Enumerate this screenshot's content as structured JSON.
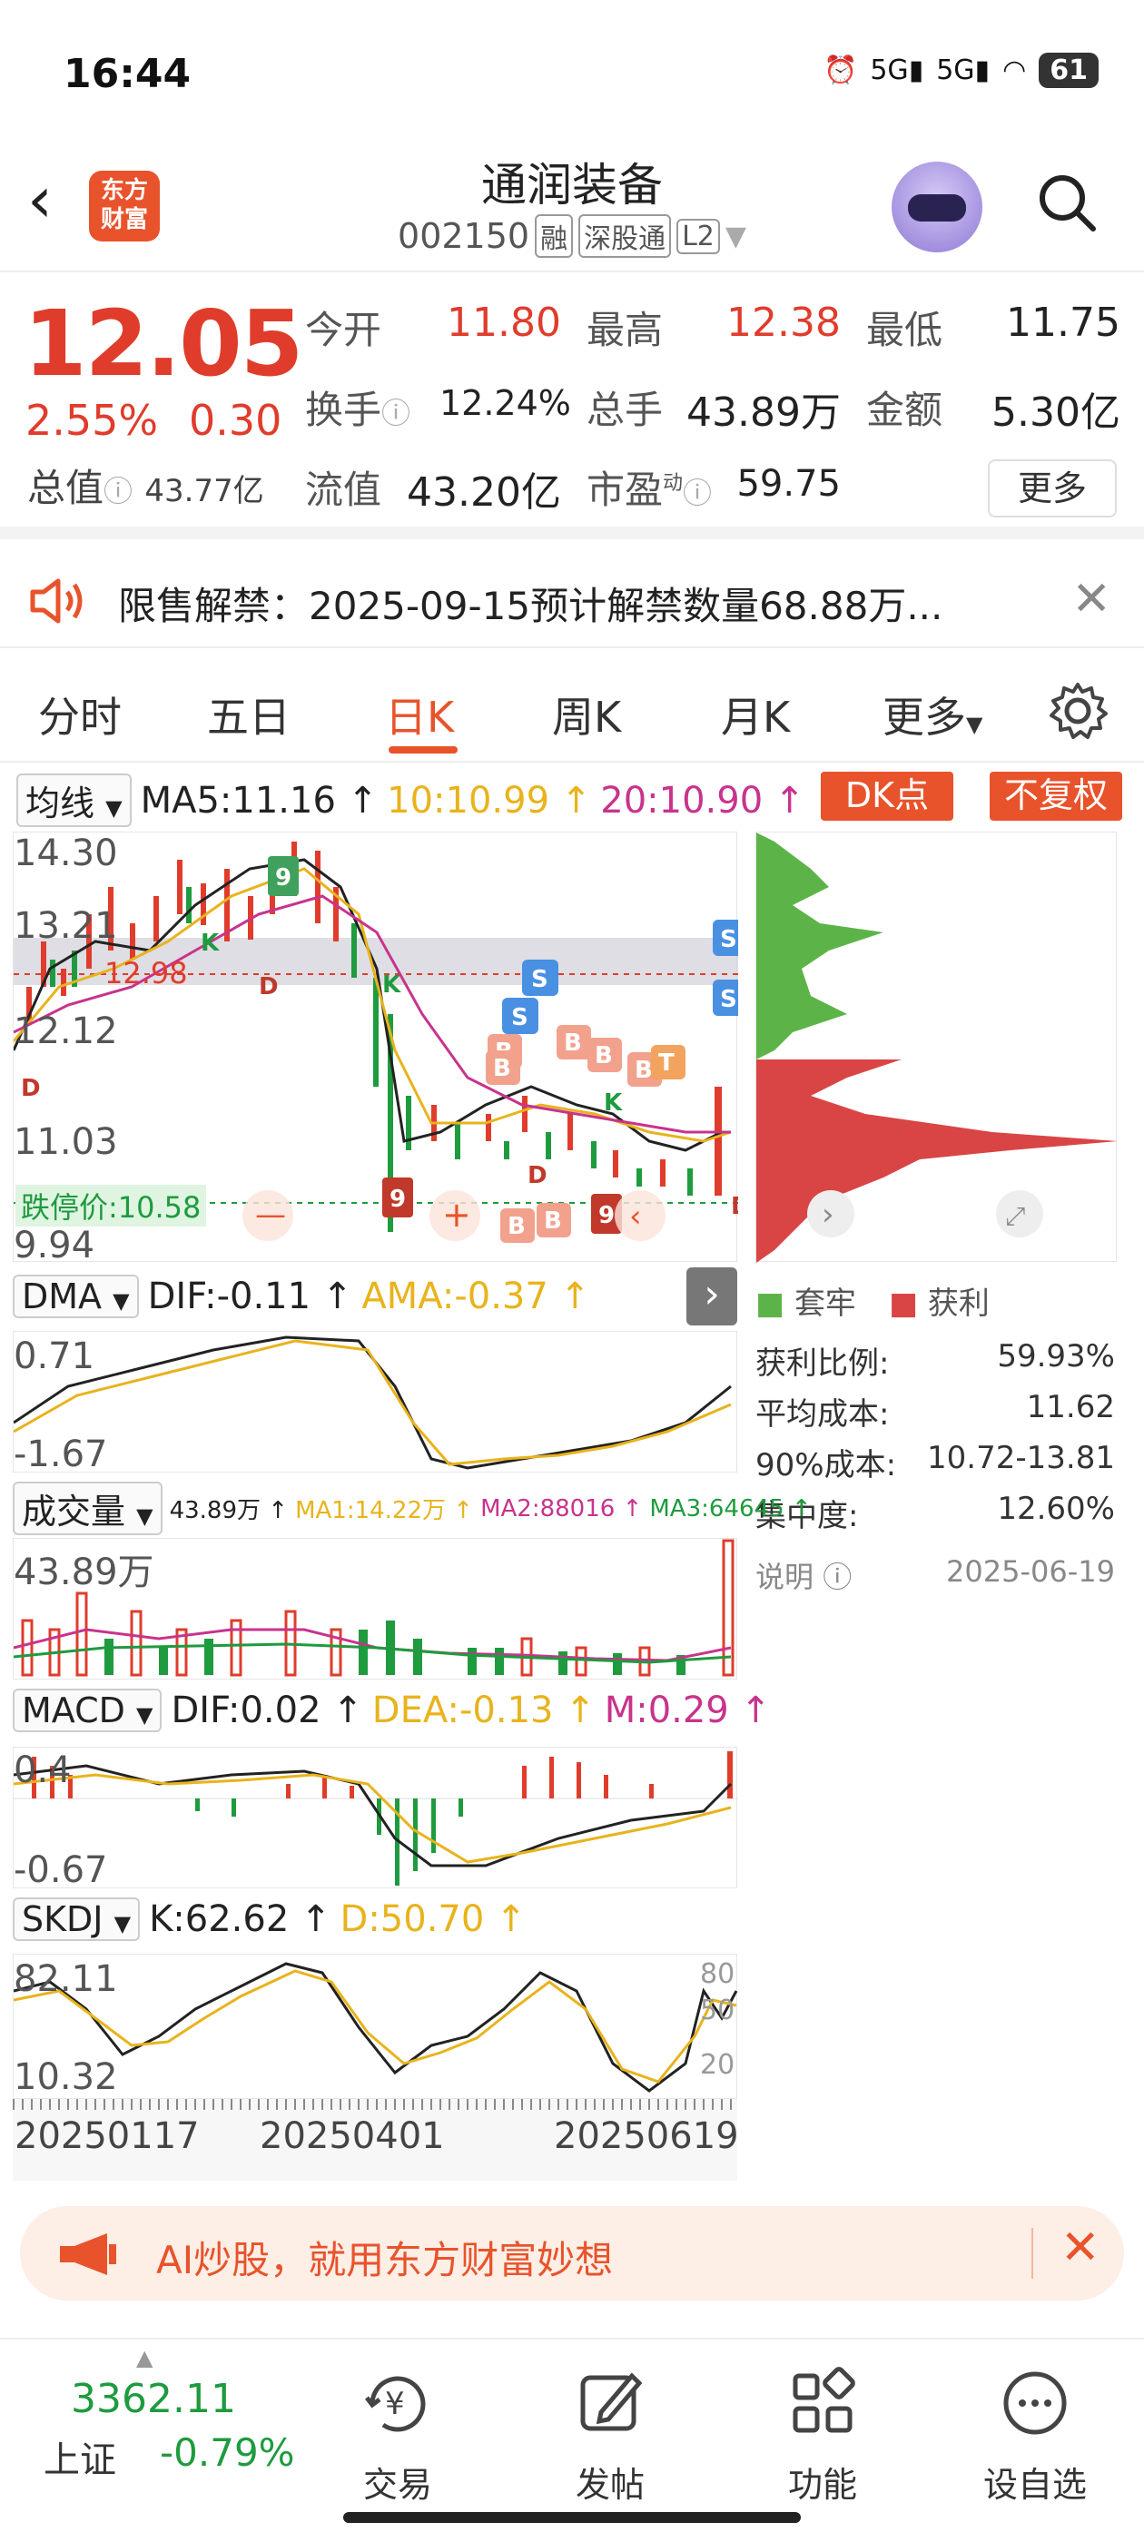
{
  "status": {
    "time": "16:44",
    "battery": "61",
    "net1": "5G",
    "net2": "5G"
  },
  "header": {
    "logo_line1": "东方",
    "logo_line2": "财富",
    "name": "通润装备",
    "code": "002150",
    "tag1": "融",
    "tag2": "深股通",
    "tag3": "L2"
  },
  "quote": {
    "price": "12.05",
    "change_pct": "2.55%",
    "change": "0.30",
    "open_label": "今开",
    "open": "11.80",
    "high_label": "最高",
    "high": "12.38",
    "low_label": "最低",
    "low": "11.75",
    "turnover_label": "换手",
    "turnover": "12.24%",
    "volume_label": "总手",
    "volume": "43.89万",
    "amount_label": "金额",
    "amount": "5.30亿",
    "mktcap_label": "总值",
    "mktcap": "43.77亿",
    "float_label": "流值",
    "float": "43.20亿",
    "pe_label": "市盈",
    "pe_sup": "动",
    "pe": "59.75",
    "more": "更多"
  },
  "notice": {
    "text": "限售解禁：2025-09-15预计解禁数量68.88万..."
  },
  "tabs": {
    "t1": "分时",
    "t2": "五日",
    "t3": "日K",
    "t4": "周K",
    "t5": "月K",
    "t6": "更多",
    "active": "日K"
  },
  "kline": {
    "ma_select": "均线",
    "ma5": "MA5:11.16 ↑",
    "ma10": "10:10.99 ↑",
    "ma20": "20:10.90 ↑",
    "dk_btn": "DK点",
    "fq_btn": "不复权",
    "y_high": "14.30",
    "y2": "13.21",
    "y3": "12.12",
    "y4": "11.03",
    "y_low": "9.94",
    "limit_down": "跌停价:10.58",
    "price_line_label": "12.98"
  },
  "chip": {
    "legend_trapped": "套牢",
    "legend_profit": "获利",
    "profit_ratio_label": "获利比例:",
    "profit_ratio": "59.93%",
    "avg_cost_label": "平均成本:",
    "avg_cost": "11.62",
    "cost90_label": "90%成本:",
    "cost90": "10.72-13.81",
    "concentration_label": "集中度:",
    "concentration": "12.60%",
    "note_label": "说明",
    "date": "2025-06-19",
    "colors": {
      "trapped": "#5cb449",
      "profit": "#d94545"
    }
  },
  "dma": {
    "select": "DMA",
    "dif": "DIF:-0.11 ↑",
    "ama": "AMA:-0.37 ↑",
    "y_high": "0.71",
    "y_low": "-1.67"
  },
  "vol": {
    "select": "成交量",
    "v": "43.89万 ↑",
    "ma1": "MA1:14.22万 ↑",
    "ma2": "MA2:88016 ↑",
    "ma3": "MA3:64645 ↑",
    "y_high": "43.89万"
  },
  "macd": {
    "select": "MACD",
    "dif": "DIF:0.02 ↑",
    "dea": "DEA:-0.13 ↑",
    "m": "M:0.29 ↑",
    "y_high": "0.4",
    "y_low": "-0.67"
  },
  "skdj": {
    "select": "SKDJ",
    "k": "K:62.62 ↑",
    "d": "D:50.70 ↑",
    "y_high": "82.11",
    "y_low": "10.32",
    "r80": "80",
    "r50": "50",
    "r20": "20"
  },
  "dates": {
    "d1": "20250117",
    "d2": "20250401",
    "d3": "20250619"
  },
  "banner": {
    "text": "AI炒股，就用东方财富妙想"
  },
  "nav": {
    "index_value": "3362.11",
    "index_name": "上证",
    "index_change": "-0.79%",
    "trade": "交易",
    "post": "发帖",
    "func": "功能",
    "watch": "设自选"
  },
  "colors": {
    "accent": "#e8532b",
    "up": "#e03c2c",
    "down": "#1e9b3e"
  }
}
